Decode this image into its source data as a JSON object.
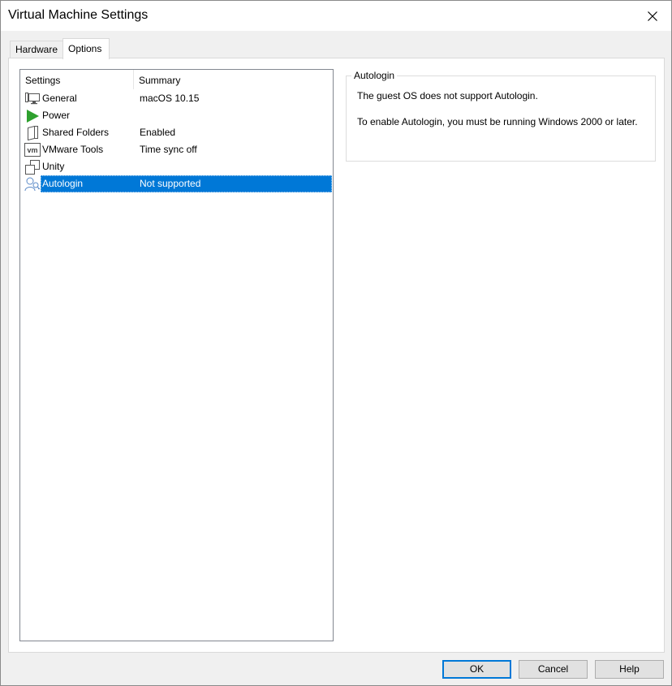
{
  "window": {
    "title": "Virtual Machine Settings"
  },
  "tabs": [
    {
      "label": "Hardware",
      "active": false
    },
    {
      "label": "Options",
      "active": true
    }
  ],
  "list": {
    "columns": [
      "Settings",
      "Summary"
    ],
    "rows": [
      {
        "name": "General",
        "summary": "macOS 10.15",
        "icon": "monitor-icon"
      },
      {
        "name": "Power",
        "summary": "",
        "icon": "power-play-icon"
      },
      {
        "name": "Shared Folders",
        "summary": "Enabled",
        "icon": "shared-folder-icon"
      },
      {
        "name": "VMware Tools",
        "summary": "Time sync off",
        "icon": "vmware-tools-icon"
      },
      {
        "name": "Unity",
        "summary": "",
        "icon": "unity-icon"
      },
      {
        "name": "Autologin",
        "summary": "Not supported",
        "icon": "autologin-icon",
        "selected": true
      }
    ]
  },
  "detail": {
    "group_title": "Autologin",
    "line1": "The guest OS does not support Autologin.",
    "line2": "To enable Autologin, you must be running Windows 2000 or later."
  },
  "buttons": {
    "ok": "OK",
    "cancel": "Cancel",
    "help": "Help"
  },
  "colors": {
    "selection": "#0078d7",
    "accent_green": "#2ea02e"
  }
}
